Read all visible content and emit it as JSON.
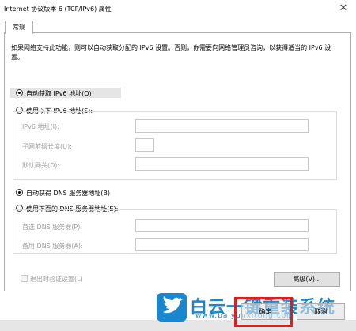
{
  "window": {
    "title": "Internet 协议版本 6 (TCP/IPv6) 属性",
    "close_glyph": "✕"
  },
  "tabs": [
    {
      "label": "常规"
    }
  ],
  "description": "如果网络支持此功能，则可以自动获取分配的 IPv6 设置。否则，你需要向网络管理员咨询，以获得适当的 IPv6 设置。",
  "ip": {
    "auto_label": "自动获取 IPv6 地址(O)",
    "manual_label": "使用以下 IPv6 地址(S):",
    "selected": "auto",
    "address_label": "IPv6 地址(I):",
    "prefix_label": "子网前缀长度(U):",
    "gateway_label": "默认网关(D):",
    "address_value": "",
    "prefix_value": "",
    "gateway_value": ""
  },
  "dns": {
    "auto_label": "自动获得 DNS 服务器地址(B)",
    "manual_label": "使用下面的 DNS 服务器地址(E):",
    "selected": "auto",
    "preferred_label": "首选 DNS 服务器(P):",
    "alternate_label": "备用 DNS 服务器(A):",
    "preferred_value": "",
    "alternate_value": ""
  },
  "validate": {
    "label": "退出时验证设置(L)",
    "checked": false
  },
  "buttons": {
    "advanced": "高级(V)...",
    "ok": "确定",
    "cancel": "取消"
  },
  "watermark": {
    "text": "白云一键重装系统",
    "url": "www.baiyunxitong.com"
  },
  "colors": {
    "accent": "#1a86d0",
    "highlight": "#e51b1b"
  }
}
